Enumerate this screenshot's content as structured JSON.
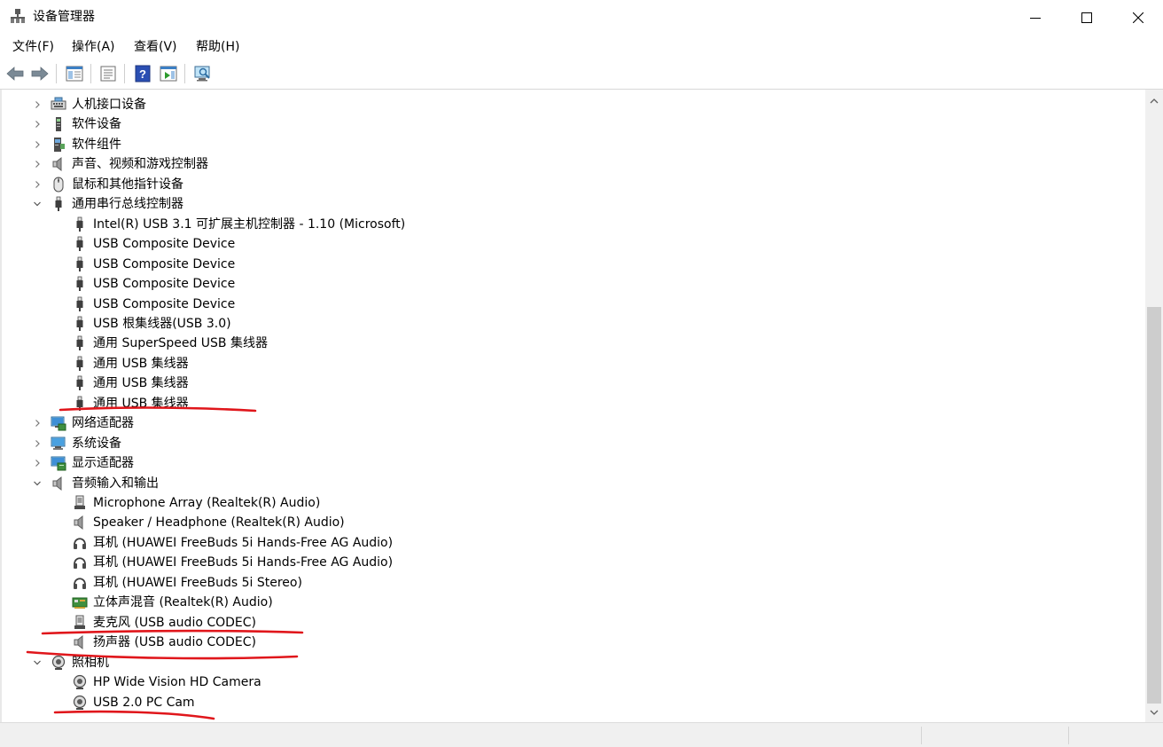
{
  "window": {
    "title": "设备管理器"
  },
  "menu": [
    "文件(F)",
    "操作(A)",
    "查看(V)",
    "帮助(H)"
  ],
  "toolbar": {
    "buttons": [
      "back-arrow-icon",
      "forward-arrow-icon",
      "console-tree-icon",
      "properties-icon",
      "help-icon",
      "action-pane-icon",
      "monitor-icon"
    ]
  },
  "tree": {
    "rows": [
      {
        "label": "人机接口设备",
        "level": 0,
        "expanded": false,
        "icon": "hid-icon"
      },
      {
        "label": "软件设备",
        "level": 0,
        "expanded": false,
        "icon": "software-device-icon"
      },
      {
        "label": "软件组件",
        "level": 0,
        "expanded": false,
        "icon": "software-component-icon"
      },
      {
        "label": "声音、视频和游戏控制器",
        "level": 0,
        "expanded": false,
        "icon": "speaker-icon"
      },
      {
        "label": "鼠标和其他指针设备",
        "level": 0,
        "expanded": false,
        "icon": "mouse-icon"
      },
      {
        "label": "通用串行总线控制器",
        "level": 0,
        "expanded": true,
        "icon": "usb-plug-icon"
      },
      {
        "label": "Intel(R) USB 3.1 可扩展主机控制器 - 1.10 (Microsoft)",
        "level": 1,
        "icon": "usb-plug-icon"
      },
      {
        "label": "USB Composite Device",
        "level": 1,
        "icon": "usb-plug-icon"
      },
      {
        "label": "USB Composite Device",
        "level": 1,
        "icon": "usb-plug-icon"
      },
      {
        "label": "USB Composite Device",
        "level": 1,
        "icon": "usb-plug-icon"
      },
      {
        "label": "USB Composite Device",
        "level": 1,
        "icon": "usb-plug-icon"
      },
      {
        "label": "USB 根集线器(USB 3.0)",
        "level": 1,
        "icon": "usb-plug-icon"
      },
      {
        "label": "通用 SuperSpeed USB 集线器",
        "level": 1,
        "icon": "usb-plug-icon"
      },
      {
        "label": "通用 USB 集线器",
        "level": 1,
        "icon": "usb-plug-icon"
      },
      {
        "label": "通用 USB 集线器",
        "level": 1,
        "icon": "usb-plug-icon"
      },
      {
        "label": "通用 USB 集线器",
        "level": 1,
        "icon": "usb-plug-icon"
      },
      {
        "label": "网络适配器",
        "level": 0,
        "expanded": false,
        "icon": "network-adapter-icon"
      },
      {
        "label": "系统设备",
        "level": 0,
        "expanded": false,
        "icon": "system-device-icon"
      },
      {
        "label": "显示适配器",
        "level": 0,
        "expanded": false,
        "icon": "display-adapter-icon"
      },
      {
        "label": "音频输入和输出",
        "level": 0,
        "expanded": true,
        "icon": "speaker-icon"
      },
      {
        "label": "Microphone Array (Realtek(R) Audio)",
        "level": 1,
        "icon": "microphone-icon"
      },
      {
        "label": "Speaker / Headphone (Realtek(R) Audio)",
        "level": 1,
        "icon": "speaker-icon"
      },
      {
        "label": "耳机 (HUAWEI FreeBuds 5i Hands-Free AG Audio)",
        "level": 1,
        "icon": "headphone-icon"
      },
      {
        "label": "耳机 (HUAWEI FreeBuds 5i Hands-Free AG Audio)",
        "level": 1,
        "icon": "headphone-icon"
      },
      {
        "label": "耳机 (HUAWEI FreeBuds 5i Stereo)",
        "level": 1,
        "icon": "headphone-icon"
      },
      {
        "label": "立体声混音 (Realtek(R) Audio)",
        "level": 1,
        "icon": "sound-card-icon"
      },
      {
        "label": "麦克风 (USB audio CODEC)",
        "level": 1,
        "icon": "microphone-icon"
      },
      {
        "label": "扬声器 (USB audio CODEC)",
        "level": 1,
        "icon": "speaker-icon"
      },
      {
        "label": "照相机",
        "level": 0,
        "expanded": true,
        "icon": "camera-icon"
      },
      {
        "label": "HP Wide Vision HD Camera",
        "level": 1,
        "icon": "camera-icon"
      },
      {
        "label": "USB 2.0 PC Cam",
        "level": 1,
        "icon": "camera-icon"
      }
    ]
  },
  "colors": {
    "annotation": "#e0161b",
    "selection": "#cce8ff"
  }
}
